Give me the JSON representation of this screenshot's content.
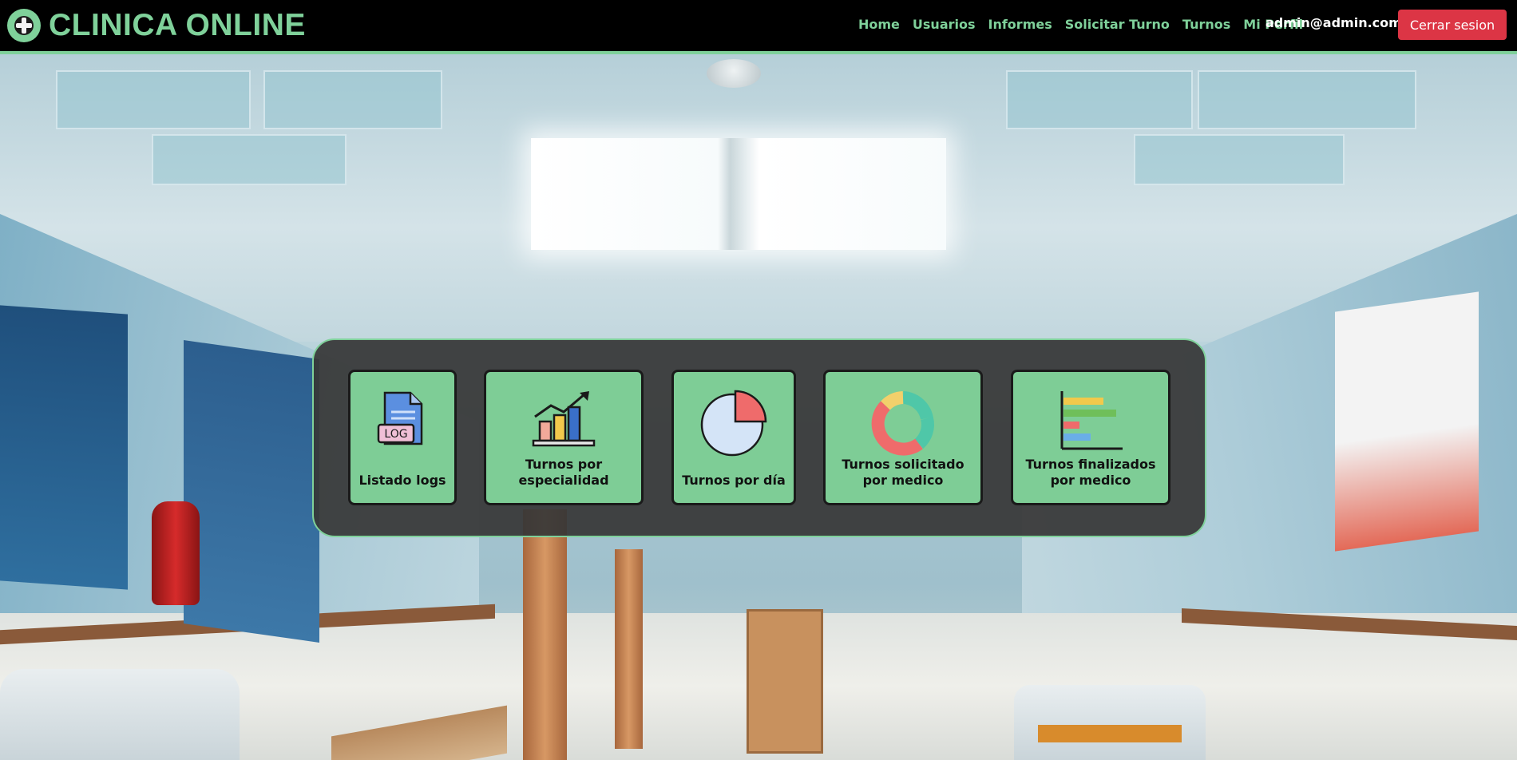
{
  "brand": {
    "title": "CLINICA ONLINE",
    "icon": "medical-cross-icon"
  },
  "nav": {
    "links": [
      "Home",
      "Usuarios",
      "Informes",
      "Solicitar Turno",
      "Turnos",
      "Mi Perfil"
    ],
    "user_email": "admin@admin.com",
    "logout_label": "Cerrar sesion"
  },
  "colors": {
    "accent": "#7fd19a",
    "navbar_bg": "#000000",
    "logout": "#dc3545",
    "panel_bg": "#373737",
    "card_bg": "#7ecd96"
  },
  "reports": {
    "cards": [
      {
        "label": "Listado logs",
        "icon": "log-file-icon",
        "icon_text": "LOG"
      },
      {
        "label": "Turnos por especialidad",
        "icon": "bar-chart-growth-icon"
      },
      {
        "label": "Turnos por día",
        "icon": "pie-chart-icon"
      },
      {
        "label": "Turnos solicitado por medico",
        "icon": "donut-chart-icon"
      },
      {
        "label": "Turnos finalizados por medico",
        "icon": "horizontal-bar-chart-icon"
      }
    ]
  }
}
